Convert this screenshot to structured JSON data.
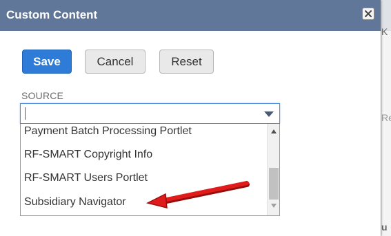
{
  "dialog": {
    "title": "Custom Content",
    "close_icon": "close-x-icon"
  },
  "toolbar": {
    "save_label": "Save",
    "cancel_label": "Cancel",
    "reset_label": "Reset"
  },
  "source": {
    "label": "SOURCE",
    "value": "",
    "dropdown_icon": "caret-down-icon",
    "options": [
      "Payment Batch Processing Portlet",
      "RF-SMART Copyright Info",
      "RF-SMART Users Portlet",
      "Subsidiary Navigator"
    ]
  },
  "background": {
    "fragments": [
      "K",
      "Re",
      "u"
    ]
  },
  "colors": {
    "titlebar": "#607799",
    "primary_button": "#2f7bd8",
    "annotation_arrow": "#e01b1b",
    "focus_border": "#4a90d9"
  }
}
